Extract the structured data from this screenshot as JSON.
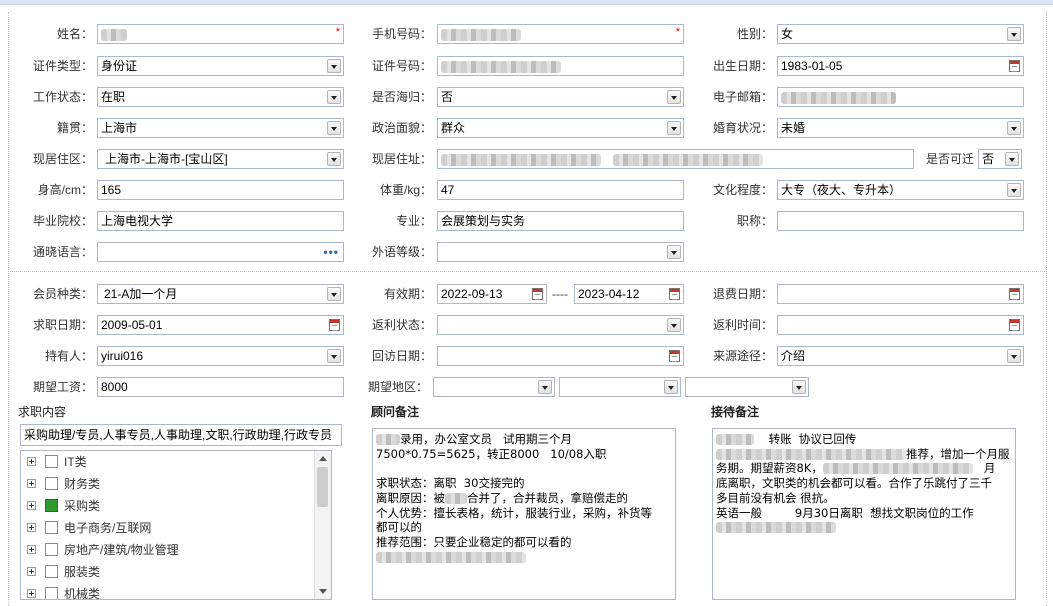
{
  "colors": {
    "field_border": "#a9b8cc",
    "required": "#dd0000",
    "checked": "#2d9b2d"
  },
  "personal": {
    "name_label": "姓名：",
    "phone_label": "手机号码：",
    "gender_label": "性别：",
    "gender_value": "女",
    "id_type_label": "证件类型：",
    "id_type_value": "身份证",
    "id_number_label": "证件号码：",
    "birth_label": "出生日期：",
    "birth_value": "1983-01-05",
    "work_status_label": "工作状态：",
    "work_status_value": "在职",
    "overseas_label": "是否海归：",
    "overseas_value": "否",
    "email_label": "电子邮箱：",
    "native_label": "籍贯：",
    "native_value": "上海市",
    "political_label": "政治面貌：",
    "political_value": "群众",
    "marital_label": "婚育状况：",
    "marital_value": "未婚",
    "residence_area_label": "现居住区：",
    "residence_area_value": "上海市-上海市-[宝山区]",
    "address_label": "现居住址：",
    "relocate_label": "是否可迁",
    "relocate_value": "否",
    "height_label": "身高/cm：",
    "height_value": "165",
    "weight_label": "体重/kg：",
    "weight_value": "47",
    "education_label": "文化程度：",
    "education_value": "大专（夜大、专升本）",
    "school_label": "毕业院校：",
    "school_value": "上海电视大学",
    "major_label": "专业：",
    "major_value": "会展策划与实务",
    "title_label": "职称：",
    "languages_label": "通晓语言：",
    "foreign_label": "外语等级："
  },
  "membership": {
    "type_label": "会员种类：",
    "type_value": "21-A加一个月",
    "valid_label": "有效期：",
    "valid_from": "2022-09-13",
    "valid_sep": "----",
    "valid_to": "2023-04-12",
    "refund_date_label": "退费日期：",
    "job_date_label": "求职日期：",
    "job_date_value": "2009-05-01",
    "rebate_status_label": "返利状态：",
    "rebate_time_label": "返利时间：",
    "holder_label": "持有人：",
    "holder_value": "yirui016",
    "visit_label": "回访日期：",
    "source_label": "来源途径：",
    "source_value": "介绍",
    "salary_label": "期望工资：",
    "salary_value": "8000",
    "area_label": "期望地区："
  },
  "job_content": {
    "title": "求职内容",
    "summary": "采购助理/专员,人事专员,人事助理,文职,行政助理,行政专员",
    "items": [
      {
        "label": "IT类",
        "checked": false
      },
      {
        "label": "财务类",
        "checked": false
      },
      {
        "label": "采购类",
        "checked": true
      },
      {
        "label": "电子商务/互联网",
        "checked": false
      },
      {
        "label": "房地产/建筑/物业管理",
        "checked": false
      },
      {
        "label": "服装类",
        "checked": false
      },
      {
        "label": "机械类",
        "checked": false
      }
    ]
  },
  "consultant_note": {
    "title": "顾问备注",
    "lines": [
      "录用，办公室文员   试用期三个月",
      "7500*0.75=5625，转正8000   10/08入职",
      "",
      "求职状态：离职  30交接完的",
      "离职原因：被",
      "合并了，合并裁员，拿赔偿走的",
      "个人优势：擅长表格，统计，服装行业，采购，补货等",
      "都可以的",
      "推荐范围：只要企业稳定的都可以看的"
    ]
  },
  "reception_note": {
    "title": "接待备注",
    "l1": "转账  协议已回传",
    "l2": "推荐，增加一个月服",
    "l3": "务期。期望薪资8K，",
    "l3b": "月",
    "l4": "底离职，文职类的机会都可以看。合作了乐跳付了三千",
    "l5": "多目前没有机会 很抗。",
    "l6a": "英语一般",
    "l6b": "9月30日离职  想找文职岗位的工作"
  }
}
